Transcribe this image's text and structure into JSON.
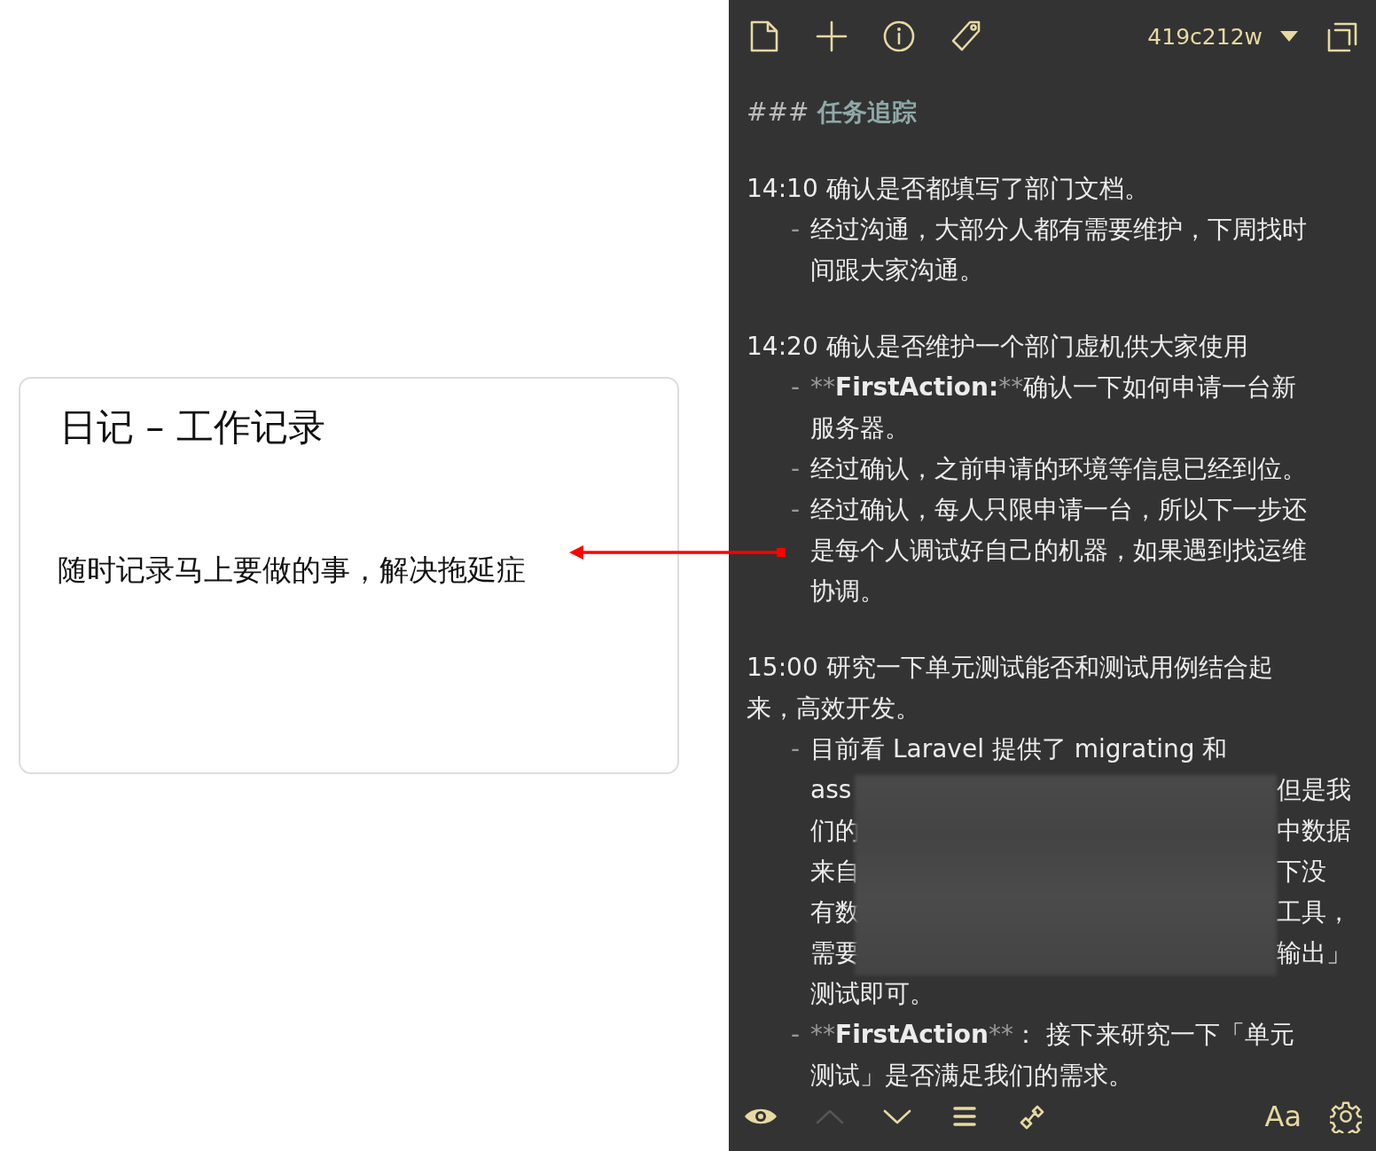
{
  "card": {
    "title": "日记 – 工作记录",
    "caption": "随时记录马上要做的事，解决拖延症"
  },
  "editor": {
    "toolbar": {
      "branch": "419c212w"
    },
    "heading": {
      "marker": "###",
      "text": "任务追踪"
    },
    "entries": [
      {
        "title": "14:10  确认是否都填写了部门文档。",
        "bullets": [
          {
            "kind": "plain",
            "dash": "-",
            "text": "经过沟通，大部分人都有需要维护，下周找时间跟大家沟通。"
          }
        ]
      },
      {
        "title": "14:20 确认是否维护一个部门虚机供大家使用",
        "bullets": [
          {
            "kind": "action",
            "dash": "-",
            "open": "**",
            "bold": "FirstAction:",
            "close": "**",
            "text": "确认一下如何申请一台新服务器。"
          },
          {
            "kind": "plain",
            "dash": "-",
            "text": "经过确认，之前申请的环境等信息已经到位。"
          },
          {
            "kind": "plain",
            "dash": "-",
            "text": "经过确认，每人只限申请一台，所以下一步还是每个人调试好自己的机器，如果遇到找运维协调。"
          }
        ]
      },
      {
        "title": "15:00  研究一下单元测试能否和测试用例结合起来，高效开发。",
        "bullets": [
          {
            "kind": "obscured",
            "dash": "-",
            "text": "目前看 Laravel 提供了 migrating 和",
            "lines": [
              {
                "left": "ass",
                "right": "但是我"
              },
              {
                "left": "们的",
                "right": "中数据"
              },
              {
                "left": "来自",
                "right": "下没"
              },
              {
                "left": "有数",
                "right": "工具，"
              },
              {
                "left": "需要",
                "right": "输出」"
              }
            ],
            "tail": "测试即可。"
          },
          {
            "kind": "action",
            "dash": "-",
            "open": "**",
            "bold": "FirstAction",
            "close": "**",
            "text": "： 接下来研究一下「单元测试」是否满足我们的需求。"
          }
        ]
      }
    ],
    "bottom_toolbar": {
      "up_disabled": true,
      "font_label": "Aa"
    }
  }
}
